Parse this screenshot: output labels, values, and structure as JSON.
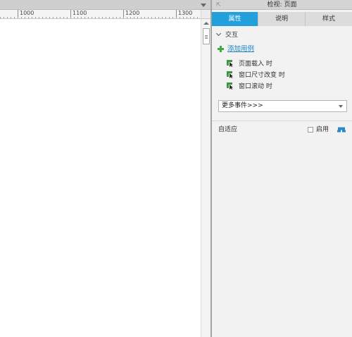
{
  "ruler": {
    "labels": [
      "1000",
      "1100",
      "1200",
      "1300"
    ]
  },
  "inspector": {
    "title": "检视: 页面",
    "tabs": [
      {
        "label": "属性",
        "active": true
      },
      {
        "label": "说明",
        "active": false
      },
      {
        "label": "样式",
        "active": false
      }
    ],
    "interaction": {
      "section_label": "交互",
      "add_case_label": "添加用例",
      "events": [
        {
          "label": "页面载入 时",
          "icon": "cursor-event-icon"
        },
        {
          "label": "窗口尺寸改变 时",
          "icon": "cursor-event-icon"
        },
        {
          "label": "窗口滚动 时",
          "icon": "cursor-event-icon"
        }
      ],
      "more_events_label": "更多事件>>>"
    },
    "adaptive": {
      "label": "自适应",
      "enable_label": "启用",
      "enabled": false
    }
  },
  "colors": {
    "accent": "#21a0dc",
    "add_green": "#42a842",
    "link_blue": "#1b83c4"
  }
}
